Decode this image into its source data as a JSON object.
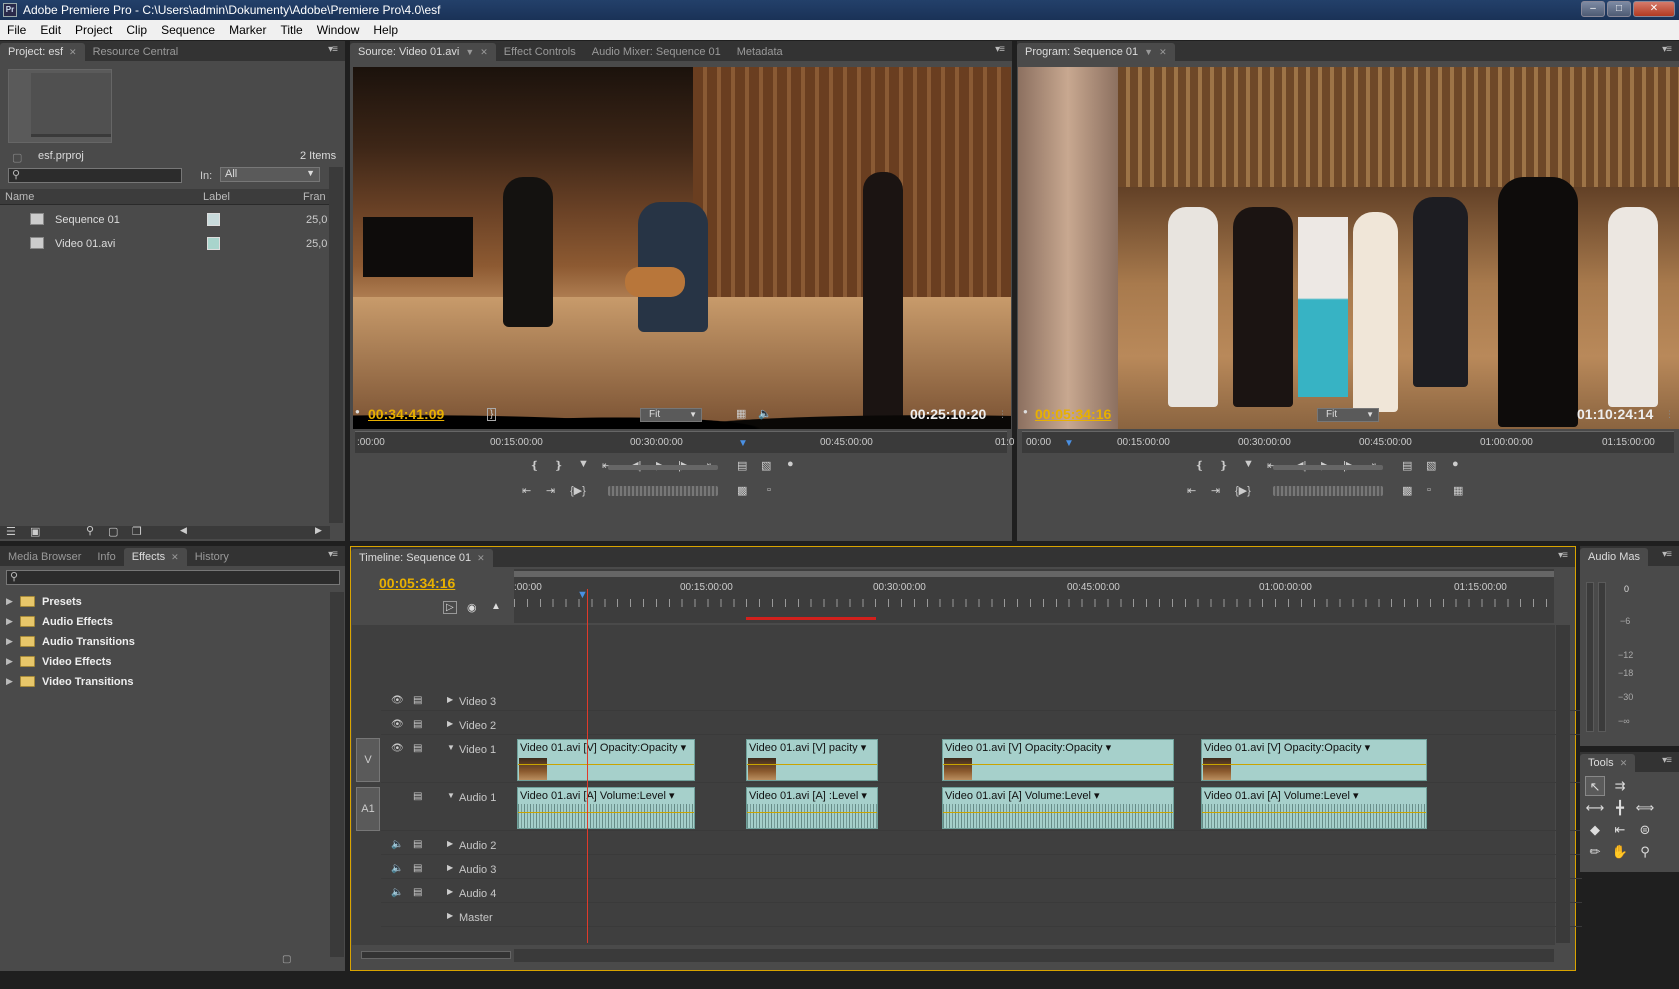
{
  "window": {
    "title": "Adobe Premiere Pro - C:\\Users\\admin\\Dokumenty\\Adobe\\Premiere Pro\\4.0\\esf",
    "app_icon": "Pr"
  },
  "menu": [
    "File",
    "Edit",
    "Project",
    "Clip",
    "Sequence",
    "Marker",
    "Title",
    "Window",
    "Help"
  ],
  "project_panel": {
    "tabs": [
      "Project: esf",
      "Resource Central"
    ],
    "project_name": "esf.prproj",
    "item_count": "2 Items",
    "in_label": "In:",
    "in_value": "All",
    "columns": [
      "Name",
      "Label",
      "Fran"
    ],
    "items": [
      {
        "name": "Sequence 01",
        "fps": "25,0",
        "label_color": "#c8dadb"
      },
      {
        "name": "Video 01.avi",
        "fps": "25,0",
        "label_color": "#a8d4cc"
      }
    ]
  },
  "source_monitor": {
    "tabs": [
      "Source: Video 01.avi",
      "Effect Controls",
      "Audio Mixer: Sequence 01",
      "Metadata"
    ],
    "current_tc": "00:34:41:09",
    "duration_tc": "00:25:10:20",
    "fit": "Fit",
    "ruler": [
      ":00:00",
      "00:15:00:00",
      "00:30:00:00",
      "00:45:00:00",
      "01:0"
    ]
  },
  "program_monitor": {
    "tabs": [
      "Program: Sequence 01"
    ],
    "current_tc": "00:05:34:16",
    "duration_tc": "01:10:24:14",
    "fit": "Fit",
    "ruler": [
      "00:00",
      "00:15:00:00",
      "00:30:00:00",
      "00:45:00:00",
      "01:00:00:00",
      "01:15:00:00"
    ]
  },
  "effects_panel": {
    "tabs": [
      "Media Browser",
      "Info",
      "Effects",
      "History"
    ],
    "folders": [
      "Presets",
      "Audio Effects",
      "Audio Transitions",
      "Video Effects",
      "Video Transitions"
    ]
  },
  "timeline": {
    "tab": "Timeline: Sequence 01",
    "current_tc": "00:05:34:16",
    "ruler": [
      ":00:00",
      "00:15:00:00",
      "00:30:00:00",
      "00:45:00:00",
      "01:00:00:00",
      "01:15:00:00"
    ],
    "tracks": {
      "video": [
        "Video 3",
        "Video 2",
        "Video 1"
      ],
      "audio": [
        "Audio 1",
        "Audio 2",
        "Audio 3",
        "Audio 4",
        "Master"
      ],
      "v_target": "V",
      "a_target": "A1"
    },
    "video_clips": [
      {
        "name": "Video 01.avi [V]",
        "fx": "Opacity:Opacity"
      },
      {
        "name": "Video 01.avi [V]",
        "fx": "pacity"
      },
      {
        "name": "Video 01.avi [V]",
        "fx": "Opacity:Opacity"
      },
      {
        "name": "Video 01.avi [V]",
        "fx": "Opacity:Opacity"
      }
    ],
    "audio_clips": [
      {
        "name": "Video 01.avi [A]",
        "fx": "Volume:Level"
      },
      {
        "name": "Video 01.avi [A]",
        "fx": ":Level"
      },
      {
        "name": "Video 01.avi [A]",
        "fx": "Volume:Level"
      },
      {
        "name": "Video 01.avi [A]",
        "fx": "Volume:Level"
      }
    ]
  },
  "audio_master": {
    "title": "Audio Mas",
    "scale": [
      "0",
      "−6",
      "−12",
      "−18",
      "−30",
      "−∞"
    ]
  },
  "tools": {
    "title": "Tools"
  }
}
